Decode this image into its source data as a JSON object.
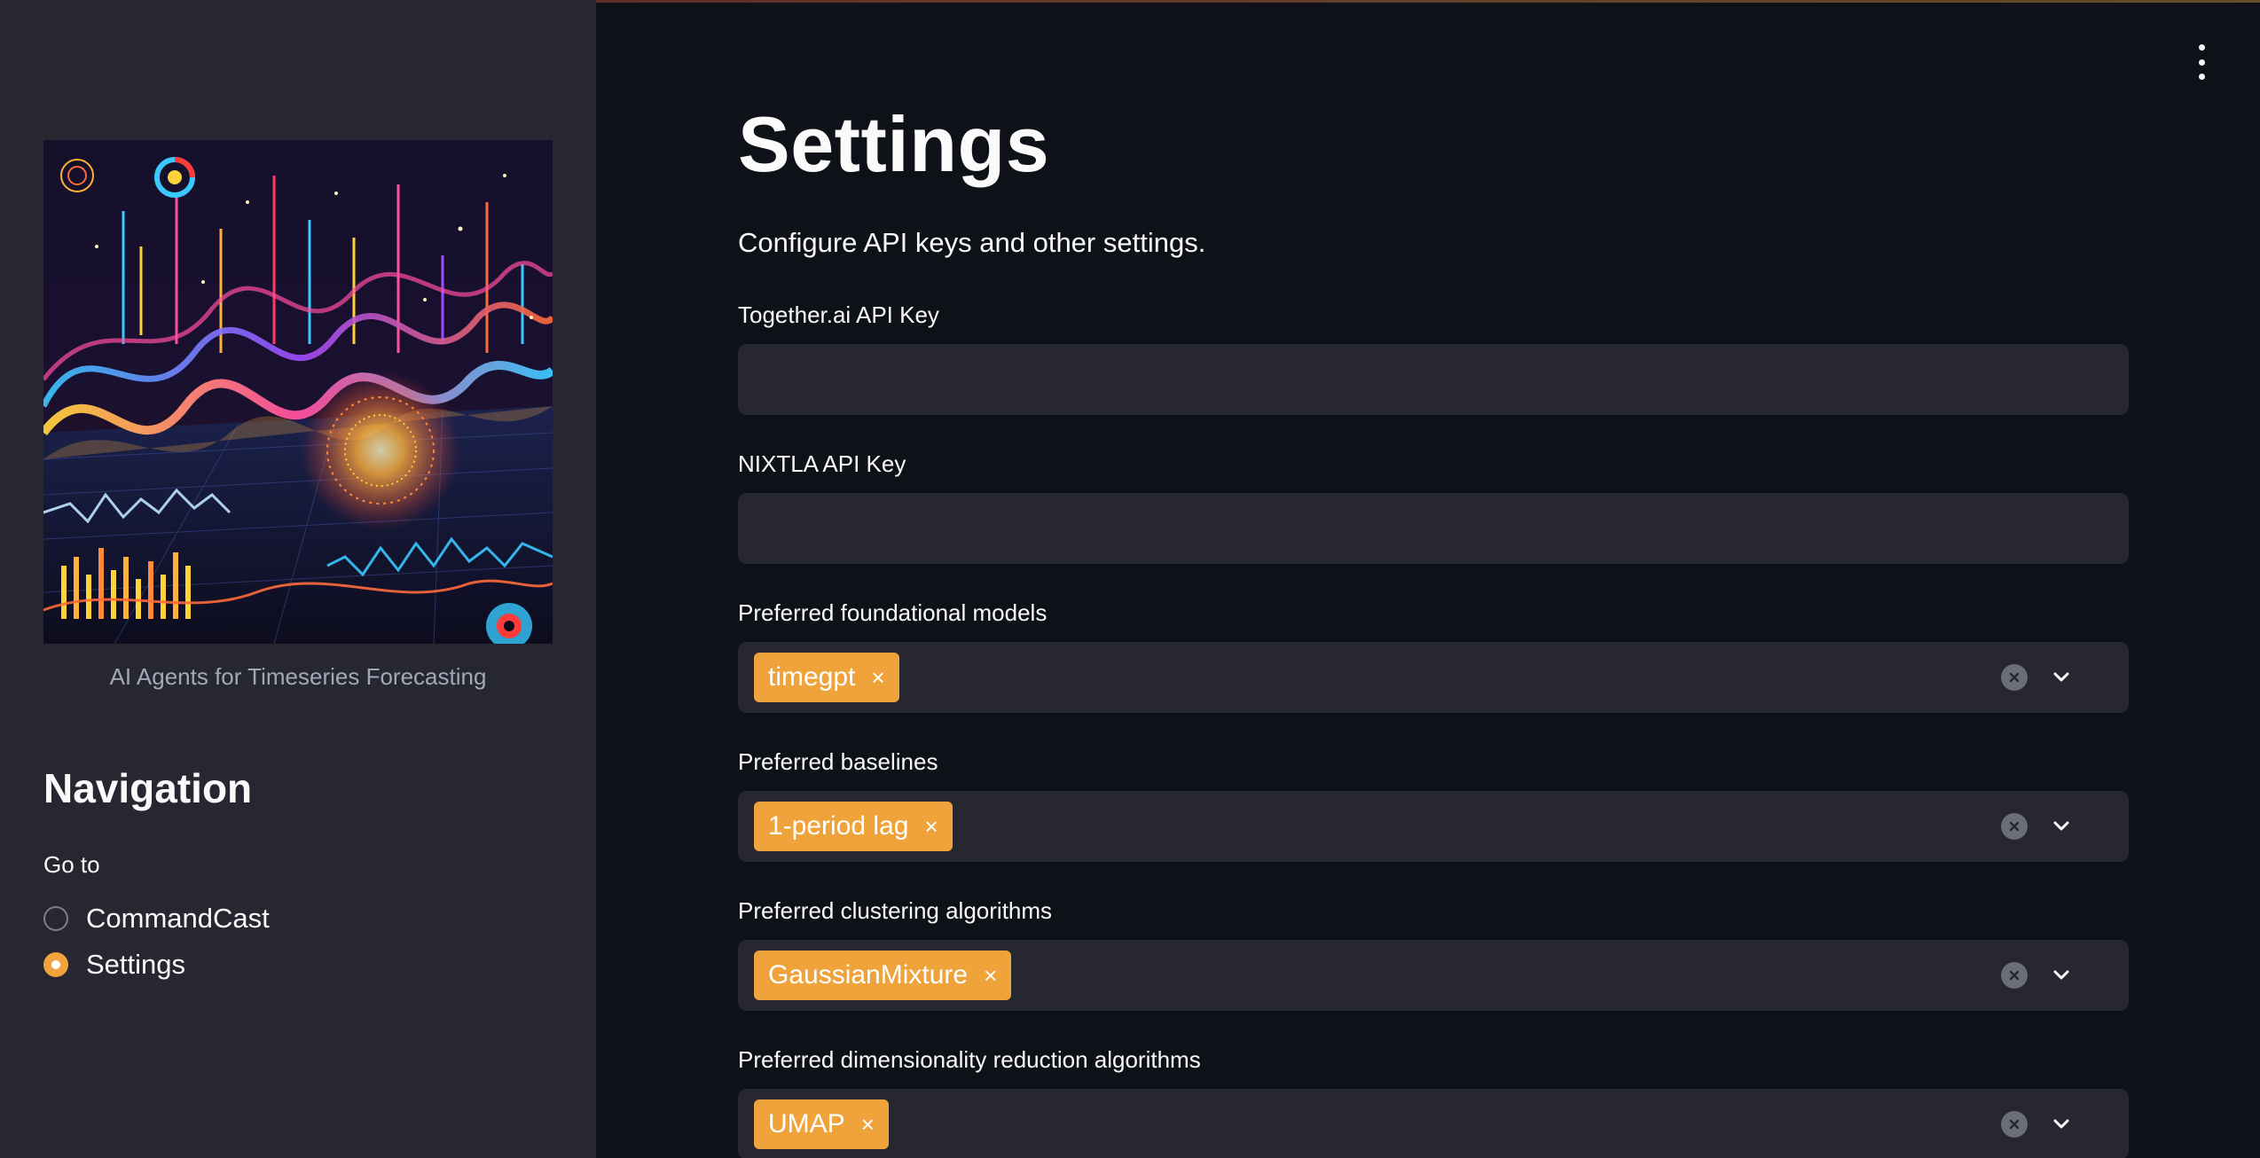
{
  "sidebar": {
    "image_caption": "AI Agents for Timeseries Forecasting",
    "navigation_title": "Navigation",
    "radio_label": "Go to",
    "options": [
      {
        "label": "CommandCast",
        "selected": false
      },
      {
        "label": "Settings",
        "selected": true
      }
    ]
  },
  "main": {
    "title": "Settings",
    "subtitle": "Configure API keys and other settings.",
    "together_key": {
      "label": "Together.ai API Key",
      "value": ""
    },
    "nixtla_key": {
      "label": "NIXTLA API Key",
      "value": ""
    },
    "foundational": {
      "label": "Preferred foundational models",
      "tags": [
        "timegpt"
      ]
    },
    "baselines": {
      "label": "Preferred baselines",
      "tags": [
        "1-period lag"
      ]
    },
    "clustering": {
      "label": "Preferred clustering algorithms",
      "tags": [
        "GaussianMixture"
      ]
    },
    "dimred": {
      "label": "Preferred dimensionality reduction algorithms",
      "tags": [
        "UMAP"
      ]
    }
  },
  "icons": {
    "tag_remove": "×",
    "menu": "more-vertical-icon",
    "clear": "clear-circle-icon",
    "dropdown": "chevron-down-icon"
  },
  "colors": {
    "accent": "#f0a33a",
    "sidebar_bg": "#262730",
    "main_bg": "#0e1117",
    "input_bg": "#262730"
  }
}
